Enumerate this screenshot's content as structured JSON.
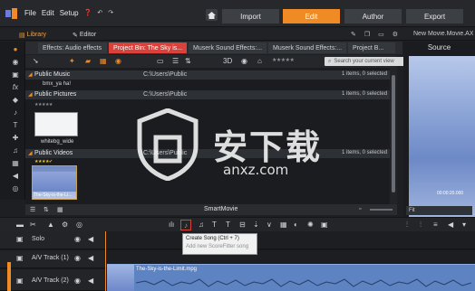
{
  "menu": {
    "file": "File",
    "edit": "Edit",
    "setup": "Setup"
  },
  "tabs": {
    "import": "Import",
    "edit": "Edit",
    "author": "Author",
    "export": "Export"
  },
  "subbar": {
    "library": "Library",
    "editor": "Editor",
    "project_name": "New Movie.Movie.AXP"
  },
  "collections": [
    {
      "label": "Effects: Audio effects",
      "active": false
    },
    {
      "label": "Project Bin: The Sky is...",
      "active": true
    },
    {
      "label": "Muserk Sound Effects:...",
      "active": false
    },
    {
      "label": "Muserk Sound Effects:...",
      "active": false
    },
    {
      "label": "Project B...",
      "active": false
    }
  ],
  "search": {
    "placeholder": "Search your current view"
  },
  "lib_toolbar": {
    "view_3d": "3D"
  },
  "folders": [
    {
      "name": "Public Music",
      "path": "C:\\Users\\Public",
      "count": "1 items, 0 selected"
    },
    {
      "name": "Public Pictures",
      "path": "C:\\Users\\Public",
      "count": "1 items, 0 selected"
    },
    {
      "name": "Public Videos",
      "path": "C:\\Users\\Public",
      "count": "1 items, 0 selected"
    }
  ],
  "items": {
    "music_file": "bmx_ya ha!",
    "picture_file": "whitebg_wide",
    "video_file": "The-Sky-is-the-Li..."
  },
  "smartmovie": {
    "title": "SmartMovie"
  },
  "preview": {
    "title": "Source",
    "timecode": "00:00:20.000",
    "fit": "Fit"
  },
  "tooltip": {
    "line1": "Create Song (Ctrl + 7)",
    "line2": "Add new ScoreFitter song"
  },
  "tracks": [
    {
      "name": "Solo"
    },
    {
      "name": "A/V Track (1)"
    },
    {
      "name": "A/V Track (2)"
    }
  ],
  "clip": {
    "label": "The-Sky-is-the-Limit.mpg"
  },
  "watermark": {
    "cn": "安下载",
    "en": "anxz.com"
  },
  "colors": {
    "accent": "#f08a25",
    "active_tab": "#d9413a",
    "clip": "#5d83c2"
  }
}
